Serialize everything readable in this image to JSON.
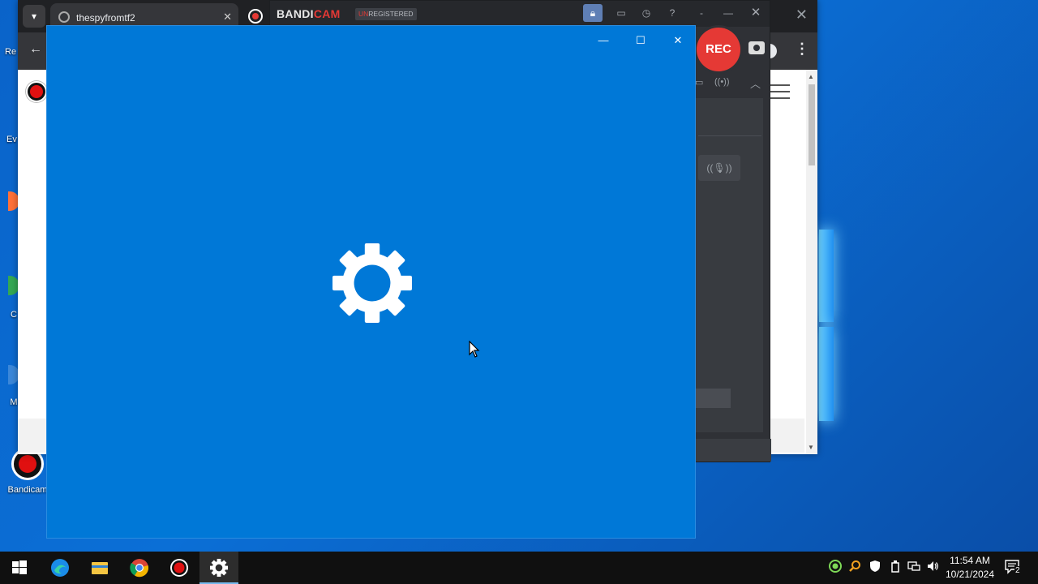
{
  "desktop": {
    "icons": [
      {
        "label": "Re"
      },
      {
        "label": "Ev"
      },
      {
        "label": ""
      },
      {
        "label": "C"
      },
      {
        "label": "M"
      },
      {
        "label": "Bandicam"
      }
    ]
  },
  "browser": {
    "tab_title": "thespyfromtf2",
    "tab_close": "✕",
    "window_close": "✕"
  },
  "bandicam": {
    "logo_bandi": "BANDI",
    "logo_cam": "CAM",
    "unregistered_prefix": "UN",
    "unregistered_rest": "REGISTERED",
    "rec_label": "REC",
    "title_buttons": [
      "folder",
      "clock",
      "?",
      "-",
      "—",
      "✕"
    ]
  },
  "settings": {
    "minimize": "—",
    "maximize": "☐",
    "close": "✕",
    "icon": "gear-icon",
    "bg_color": "#0078d7"
  },
  "taskbar": {
    "items": [
      "start",
      "edge",
      "file-explorer",
      "chrome",
      "bandicam",
      "settings"
    ],
    "active": "settings",
    "clock_time": "11:54 AM",
    "clock_date": "10/21/2024",
    "notification_count": "2"
  }
}
